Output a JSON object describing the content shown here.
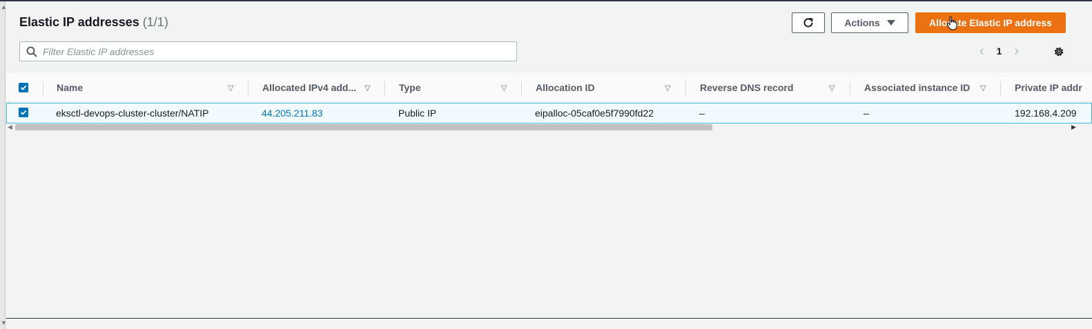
{
  "header": {
    "title": "Elastic IP addresses",
    "count": "(1/1)"
  },
  "toolbar": {
    "refresh_icon": "refresh-icon",
    "actions_label": "Actions",
    "allocate_label": "Allocate Elastic IP address"
  },
  "search": {
    "placeholder": "Filter Elastic IP addresses",
    "value": ""
  },
  "pagination": {
    "current_page": "1"
  },
  "table": {
    "columns": [
      "Name",
      "Allocated IPv4 add...",
      "Type",
      "Allocation ID",
      "Reverse DNS record",
      "Associated instance ID",
      "Private IP addr"
    ],
    "rows": [
      {
        "selected": true,
        "name": "eksctl-devops-cluster-cluster/NATIP",
        "ipv4": "44.205.211.83",
        "type": "Public IP",
        "allocation_id": "eipalloc-05caf0e5f7990fd22",
        "reverse_dns": "–",
        "instance_id": "–",
        "private_ip": "192.168.4.209"
      }
    ]
  },
  "colors": {
    "primary_button": "#ec7211",
    "link": "#0073bb",
    "selected_row_bg": "#f1faff",
    "selected_row_border": "#44b9d6"
  }
}
